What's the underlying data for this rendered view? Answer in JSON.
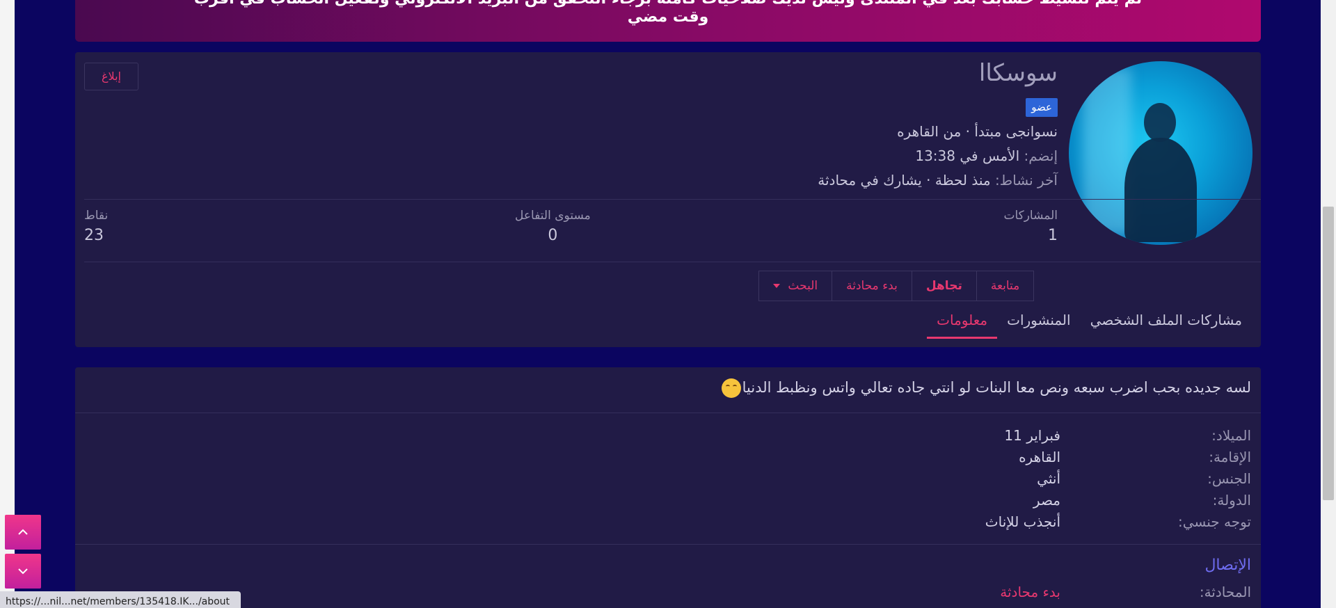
{
  "notice": {
    "line1": "لم يتم تنشيط حسابك بعد في المنتدى وليس لديك صلاحيات كاملة برجاء التحقق من البريد الالكتروني وتفعيل الحساب في اقرب",
    "line2": "وقت مضي"
  },
  "profile": {
    "username": "سوسكاا",
    "badge": "عضو",
    "title_line": "نسوانجى مبتدأ · من القاهره",
    "joined_label": "إنضم:",
    "joined_value": "الأمس في 13:38",
    "last_activity_label": "آخر نشاط:",
    "last_activity_value": "منذ لحظة · يشارك في محادثة",
    "report_button": "إبلاغ",
    "stats": {
      "posts_label": "المشاركات",
      "posts_value": "1",
      "reaction_label": "مستوى التفاعل",
      "reaction_value": "0",
      "points_label": "نقاط",
      "points_value": "23"
    },
    "actions": {
      "follow": "متابعة",
      "ignore": "تجاهل",
      "start_conversation": "بدء محادثة",
      "find": "البحث"
    },
    "tabs": [
      {
        "label": "مشاركات الملف الشخصي"
      },
      {
        "label": "المنشورات"
      },
      {
        "label": "معلومات"
      }
    ]
  },
  "about": {
    "bio": "لسه جديده بحب اضرب سبعه ونص معا البنات لو انتي جاده تعالي واتس ونظبط الدنيا",
    "fields": [
      {
        "label": "الميلاد:",
        "value": "فبراير 11"
      },
      {
        "label": "الإقامة:",
        "value": "القاهره"
      },
      {
        "label": "الجنس:",
        "value": "أنثي"
      },
      {
        "label": "الدولة:",
        "value": "مصر"
      },
      {
        "label": "توجه جنسي:",
        "value": "أنجذب للإناث"
      }
    ],
    "contact_title": "الإتصال",
    "conversation_label": "المحادثة:",
    "conversation_link": "بدء محادثة"
  },
  "status_url": "https://...nil...net/members/135418.IK.../about",
  "colors": {
    "page_bg": "#0b0560",
    "card_bg": "#211b46",
    "accent": "#e8386f",
    "link_blue": "#6e6cf0",
    "badge_bg": "#2d65d8"
  },
  "icons": {
    "scroll_up": "chevron-up-icon",
    "scroll_down": "chevron-down-icon",
    "find_caret": "caret-down-icon"
  }
}
